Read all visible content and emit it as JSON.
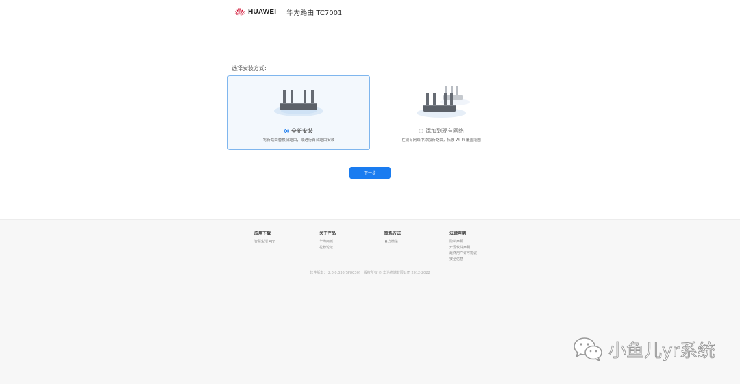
{
  "header": {
    "brand": "HUAWEI",
    "product": "华为路由 TC7001"
  },
  "setup": {
    "prompt": "选择安装方式:",
    "options": [
      {
        "label": "全新安装",
        "description": "将新路由替换旧路由，或进行首台路由安装",
        "selected": true
      },
      {
        "label": "添加到现有网络",
        "description": "在现有网络中添加新路由，拓展 Wi-Fi 覆盖范围",
        "selected": false
      }
    ],
    "next_label": "下一步"
  },
  "footer": {
    "columns": [
      {
        "title": "应用下载",
        "links": [
          "智慧生活 App"
        ]
      },
      {
        "title": "关于产品",
        "links": [
          "华为商城",
          "花粉论坛"
        ]
      },
      {
        "title": "联系方式",
        "links": [
          "官方微信"
        ]
      },
      {
        "title": "法律声明",
        "links": [
          "隐私声明",
          "开源软件声明",
          "最终用户许可协议",
          "安全信息"
        ]
      }
    ],
    "copyright": "软件版本： 2.0.0.336(SP8C30) | 版权所有 © 华为终端有限公司 2012-2022"
  },
  "watermark": {
    "text": "小鱼儿yr系统"
  },
  "colors": {
    "accent": "#1a7cf0",
    "brand_red": "#cf0a2c"
  }
}
